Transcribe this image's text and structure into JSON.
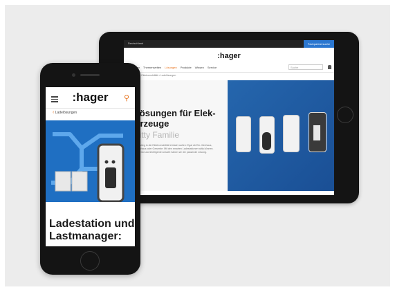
{
  "brand": "hager",
  "tablet": {
    "topbar": {
      "lang_label": "Deutschland",
      "cta_label": "Fachpartnersuche"
    },
    "logo": ":hager",
    "nav": [
      "Ihr Partner",
      "Themenwelten",
      "Lösungen",
      "Produkte",
      "Wissen",
      "Service"
    ],
    "nav_active_index": 2,
    "search_placeholder": "Suche",
    "breadcrumb": "Lösungen > Elektromobilität > Ladelösungen",
    "hero": {
      "title_line1": "delösungen für Elek-",
      "title_line2": "fahrzeuge",
      "subtitle": "n witty Familie",
      "body": "ben den Einstieg in die Elektromobilität einfach wollen: Egal ob Ein- ilienhaus, Mehrfamilienhaus oder Gewerbe: Mit den smarten Ladestationen witty können. Hello Alltedienst und intelligente Ansicht haben sie die passende Lösung."
    }
  },
  "phone": {
    "logo": ":hager",
    "search_icon": "search-icon",
    "back_label": "Ladelösungen",
    "title_line1": "Ladestation und",
    "title_line2": "Lastmanager:"
  },
  "colors": {
    "accent": "#e8731c",
    "hero_blue": "#1f6fc2",
    "cta_blue": "#2b77d0"
  }
}
